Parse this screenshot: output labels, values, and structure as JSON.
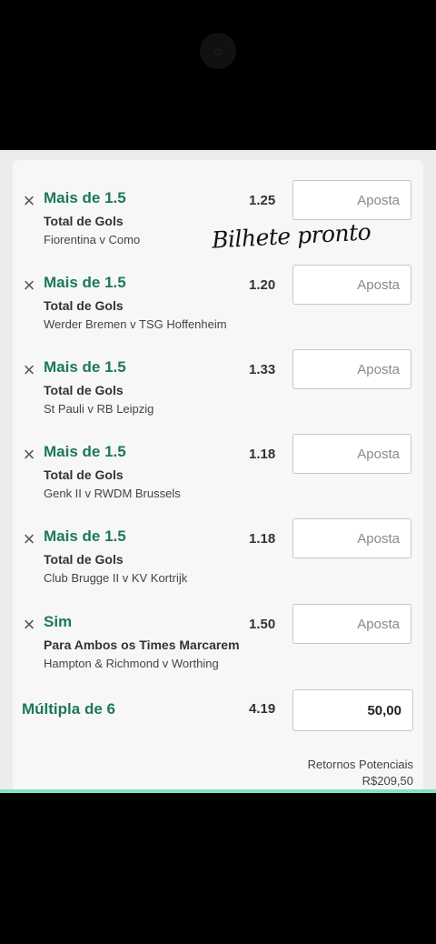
{
  "bets": [
    {
      "selection": "Mais de 1.5",
      "market": "Total de Gols",
      "event": "Fiorentina v Como",
      "odds": "1.25",
      "stake_placeholder": "Aposta"
    },
    {
      "selection": "Mais de 1.5",
      "market": "Total de Gols",
      "event": "Werder Bremen v TSG Hoffenheim",
      "odds": "1.20",
      "stake_placeholder": "Aposta"
    },
    {
      "selection": "Mais de 1.5",
      "market": "Total de Gols",
      "event": "St Pauli v RB Leipzig",
      "odds": "1.33",
      "stake_placeholder": "Aposta"
    },
    {
      "selection": "Mais de 1.5",
      "market": "Total de Gols",
      "event": "Genk II v RWDM Brussels",
      "odds": "1.18",
      "stake_placeholder": "Aposta"
    },
    {
      "selection": "Mais de 1.5",
      "market": "Total de Gols",
      "event": "Club Brugge II v KV Kortrijk",
      "odds": "1.18",
      "stake_placeholder": "Aposta"
    },
    {
      "selection": "Sim",
      "market": "Para Ambos os Times Marcarem",
      "event": "Hampton & Richmond v Worthing",
      "odds": "1.50",
      "stake_placeholder": "Aposta"
    }
  ],
  "multiple": {
    "label": "Múltipla de 6",
    "odds": "4.19",
    "stake": "50,00"
  },
  "returns": {
    "label": "Retornos Potenciais",
    "value": "R$209,50"
  },
  "overlay_text": "Bilhete pronto",
  "icons": {
    "remove": "close-icon"
  },
  "colors": {
    "accent": "#1c7a55",
    "bottom_line": "#7fe3c6"
  }
}
